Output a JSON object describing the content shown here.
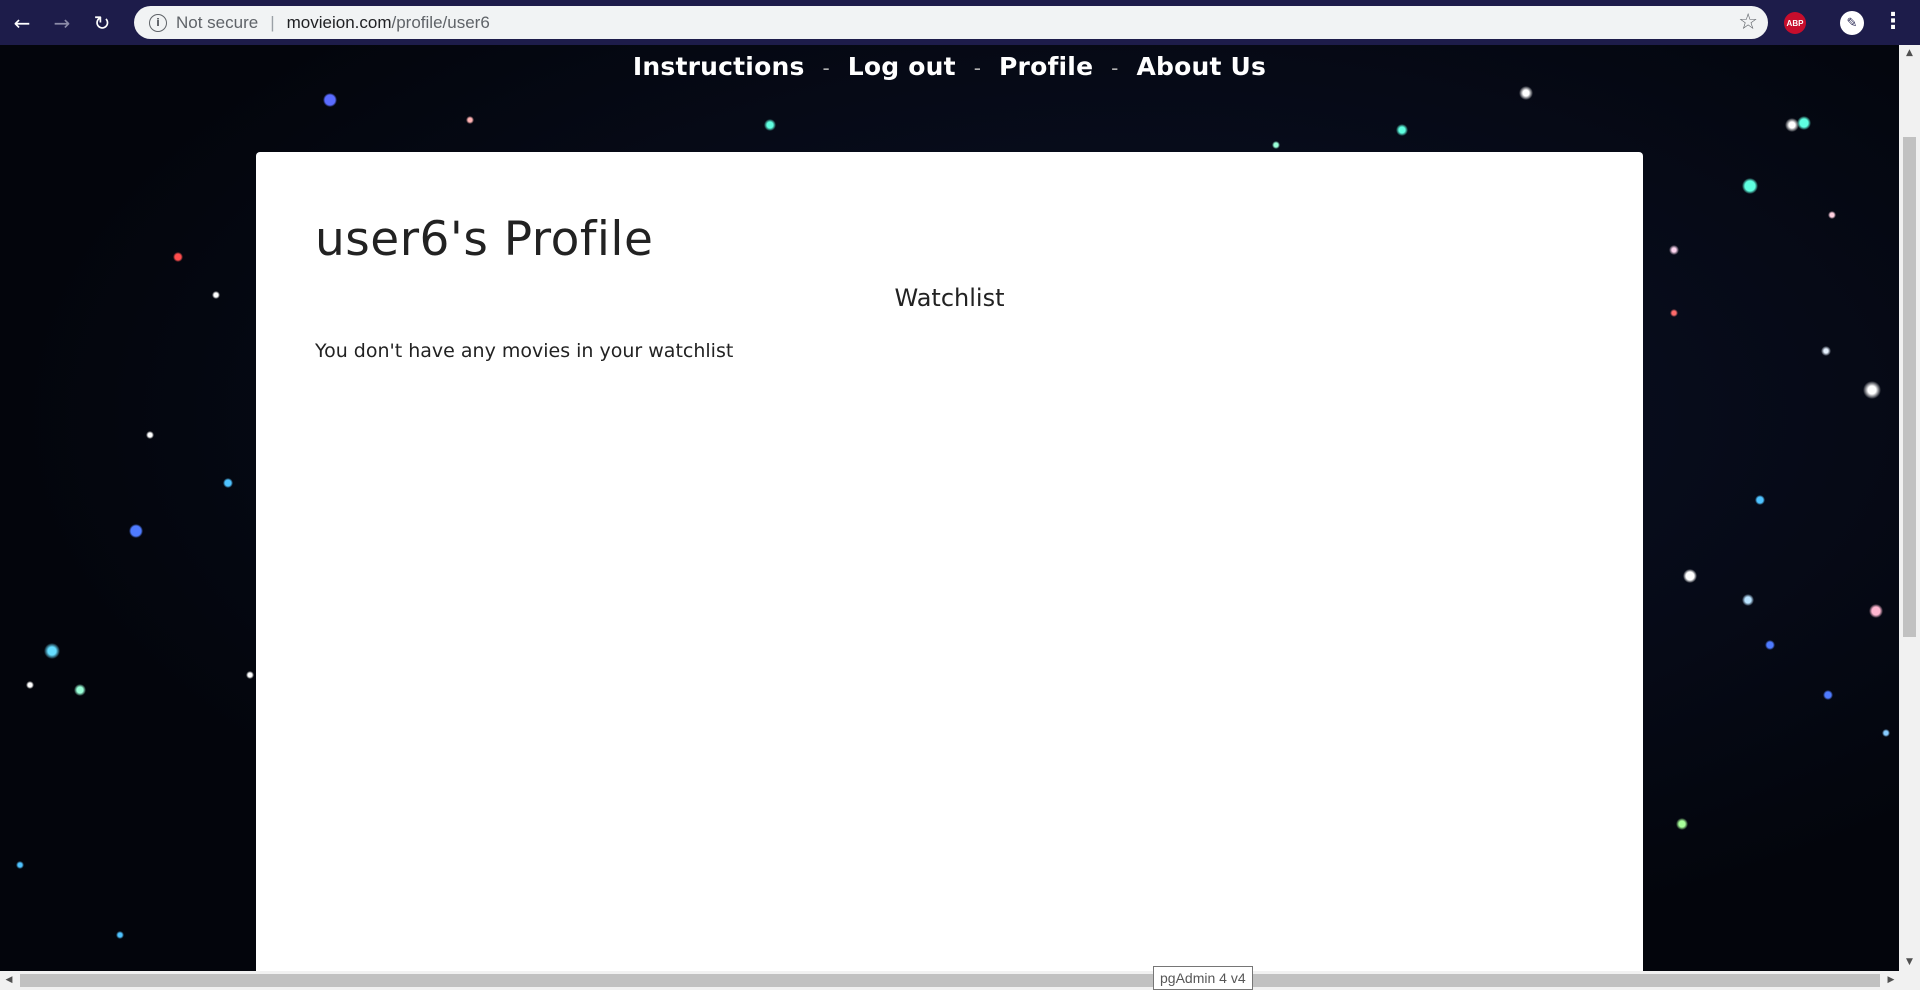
{
  "browser": {
    "back_icon": "←",
    "forward_icon": "→",
    "reload_icon": "↻",
    "info_icon": "i",
    "security_label": "Not secure",
    "url_separator": "|",
    "url_domain": "movieion.com",
    "url_path": "/profile/user6",
    "star_icon": "☆",
    "abp_label": "ABP",
    "extension_icon": "✎",
    "menu_icon": "⋮"
  },
  "nav": {
    "items": [
      {
        "label": "Instructions"
      },
      {
        "label": "Log out"
      },
      {
        "label": "Profile"
      },
      {
        "label": "About Us"
      }
    ],
    "separator": "-"
  },
  "profile": {
    "title": "user6's Profile",
    "watchlist_heading": "Watchlist",
    "empty_message": "You don't have any movies in your watchlist"
  },
  "scrollbars": {
    "up_arrow": "▲",
    "down_arrow": "▼",
    "left_arrow": "◀",
    "right_arrow": "▶"
  },
  "tooltip": {
    "text": "pgAdmin 4 v4"
  }
}
